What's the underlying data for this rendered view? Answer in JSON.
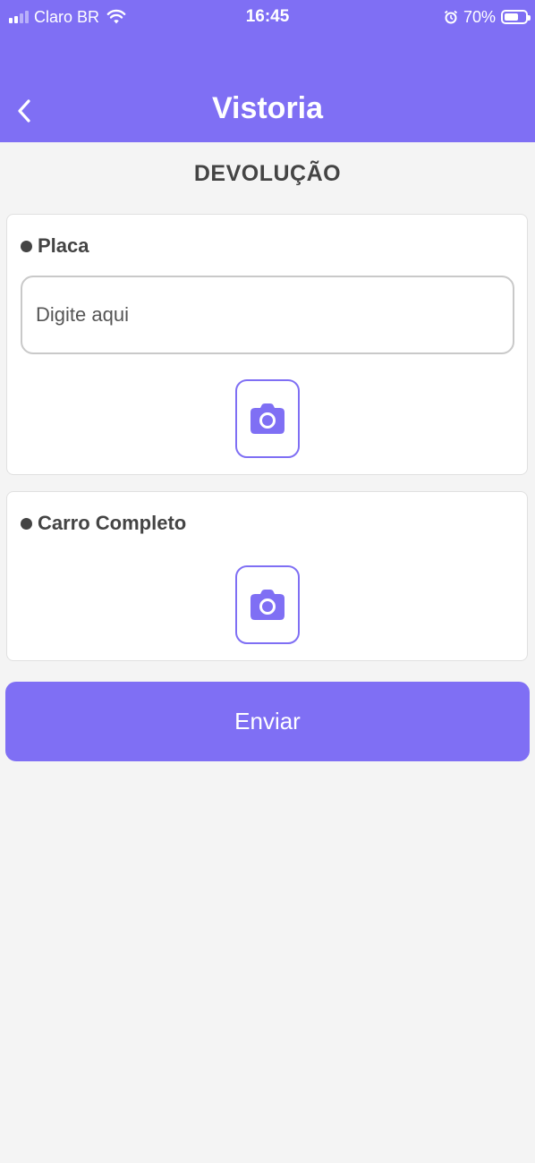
{
  "status_bar": {
    "carrier": "Claro BR",
    "time": "16:45",
    "battery_percent": "70%",
    "battery_level": 0.7,
    "icons": [
      "signal-icon",
      "wifi-icon",
      "alarm-icon",
      "battery-icon"
    ]
  },
  "header": {
    "title": "Vistoria",
    "back_icon": "chevron-left-icon"
  },
  "section": {
    "title": "DEVOLUÇÃO"
  },
  "form": {
    "placa": {
      "label": "Placa",
      "placeholder": "Digite aqui",
      "value": "",
      "camera_icon": "camera-icon"
    },
    "carro_completo": {
      "label": "Carro Completo",
      "camera_icon": "camera-icon"
    },
    "submit_label": "Enviar"
  },
  "colors": {
    "accent": "#7f6ff4",
    "background": "#f4f4f4",
    "card": "#ffffff",
    "text": "#444444"
  }
}
